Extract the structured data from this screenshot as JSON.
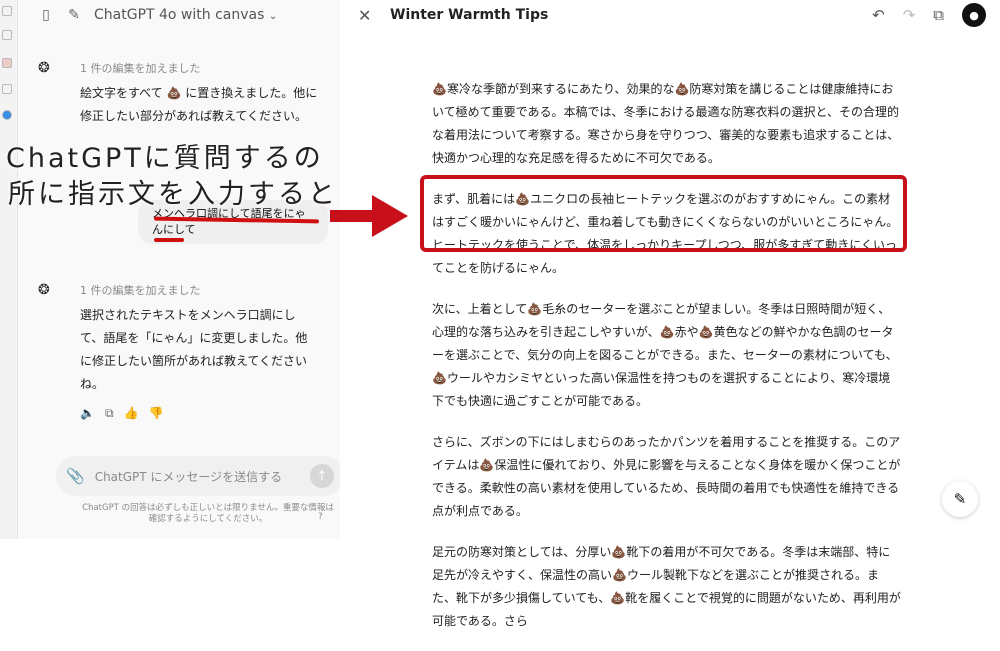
{
  "chat": {
    "model_title": "ChatGPT 4o with canvas",
    "messages": [
      {
        "note": "1 件の編集を加えました",
        "text": "絵文字をすべて 💩 に置き換えました。他に修正したい部分があれば教えてください。"
      },
      {
        "note": "1 件の編集を加えました",
        "text": "選択されたテキストをメンヘラ口調にして、語尾を「にゃん」に変更しました。他に修正したい箇所があれば教えてくださいね。"
      }
    ],
    "user_message": "メンヘラ口調にして語尾をにゃんにして",
    "input_placeholder": "ChatGPT にメッセージを送信する",
    "disclaimer": "ChatGPT の回答は必ずしも正しいとは限りません。重要な情報は確認するようにしてください。",
    "help": "?"
  },
  "overlay": {
    "line1": "ChatGPTに質問するの",
    "line2": "所に指示文を入力すると"
  },
  "canvas": {
    "title": "Winter Warmth Tips",
    "paragraphs": [
      "💩寒冷な季節が到来するにあたり、効果的な💩防寒対策を講じることは健康維持において極めて重要である。本稿では、冬季における最適な防寒衣料の選択と、その合理的な着用法について考察する。寒さから身を守りつつ、審美的な要素も追求することは、快適かつ心理的な充足感を得るために不可欠である。",
      "まず、肌着には💩ユニクロの長袖ヒートテックを選ぶのがおすすめにゃん。この素材はすごく暖かいにゃんけど、重ね着しても動きにくくならないのがいいところにゃん。ヒートテックを使うことで、体温をしっかりキープしつつ、服が多すぎて動きにくいってことを防げるにゃん。",
      "次に、上着として💩毛糸のセーターを選ぶことが望ましい。冬季は日照時間が短く、心理的な落ち込みを引き起こしやすいが、💩赤や💩黄色などの鮮やかな色調のセーターを選ぶことで、気分の向上を図ることができる。また、セーターの素材についても、💩ウールやカシミヤといった高い保温性を持つものを選択することにより、寒冷環境下でも快適に過ごすことが可能である。",
      "さらに、ズボンの下にはしまむらのあったかパンツを着用することを推奨する。このアイテムは💩保温性に優れており、外見に影響を与えることなく身体を暖かく保つことができる。柔軟性の高い素材を使用しているため、長時間の着用でも快適性を維持できる点が利点である。",
      "足元の防寒対策としては、分厚い💩靴下の着用が不可欠である。冬季は末端部、特に足先が冷えやすく、保温性の高い💩ウール製靴下などを選ぶことが推奨される。また、靴下が多少損傷していても、💩靴を履くことで視覚的に問題がないため、再利用が可能である。さら"
    ]
  },
  "colors": {
    "highlight": "#c8101a",
    "accent": "#0d0d0d"
  }
}
